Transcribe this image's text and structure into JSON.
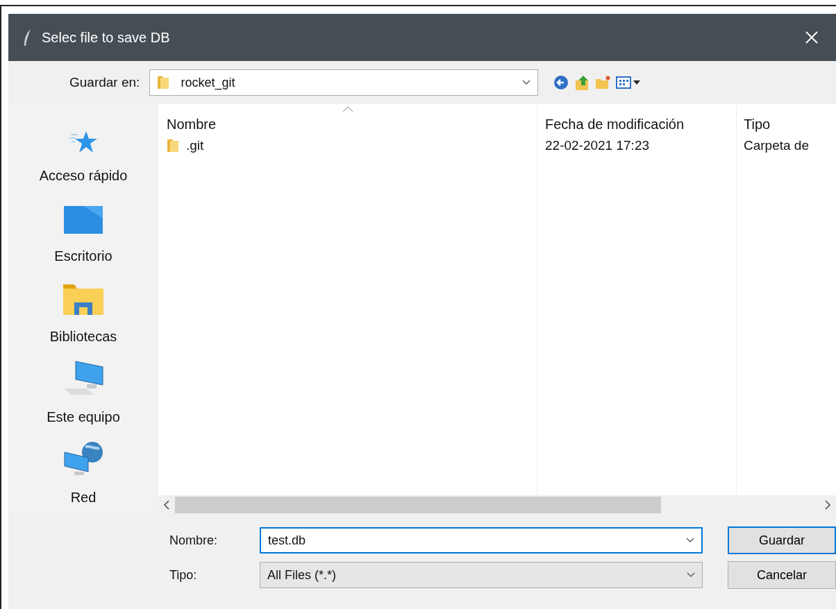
{
  "window": {
    "title": "Selec file to save DB"
  },
  "location": {
    "label": "Guardar en:",
    "value": "rocket_git"
  },
  "sidebar": {
    "items": [
      {
        "label": "Acceso rápido"
      },
      {
        "label": "Escritorio"
      },
      {
        "label": "Bibliotecas"
      },
      {
        "label": "Este equipo"
      },
      {
        "label": "Red"
      }
    ]
  },
  "table": {
    "columns": [
      {
        "label": "Nombre",
        "sorted": true
      },
      {
        "label": "Fecha de modificación",
        "sorted": false
      },
      {
        "label": "Tipo",
        "sorted": false
      }
    ],
    "rows": [
      {
        "cells": [
          ".git",
          "22-02-2021 17:23",
          "Carpeta de"
        ]
      }
    ]
  },
  "file_name": {
    "label": "Nombre:",
    "value": "test.db",
    "focused": true
  },
  "file_type": {
    "label": "Tipo:",
    "value": "All Files (*.*)"
  },
  "buttons": [
    {
      "label": "Guardar",
      "default": true
    },
    {
      "label": "Cancelar",
      "default": false
    }
  ]
}
